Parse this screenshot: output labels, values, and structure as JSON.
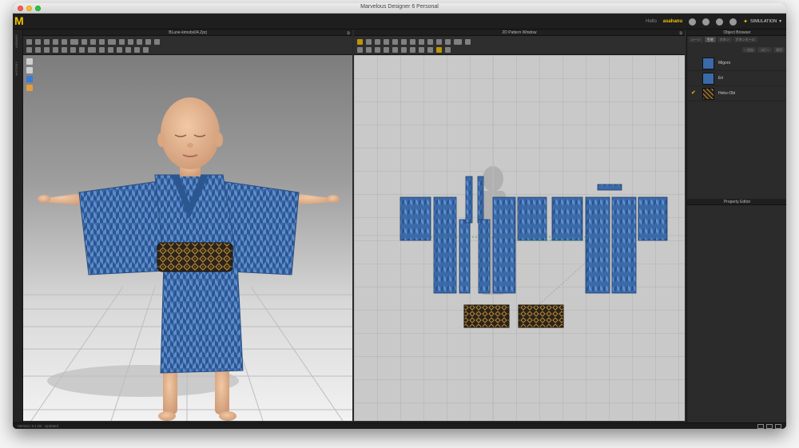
{
  "window": {
    "title": "Marvelous Designer 6 Personal"
  },
  "menu_bar": {
    "logo_letter": "M",
    "user_label": "Hello",
    "user_name": "asahanu",
    "simulation_label": "SIMULATION",
    "icons": [
      "speaker-icon",
      "user-icon",
      "help-icon",
      "cloud-icon",
      "simulation-icon"
    ]
  },
  "left_strip": {
    "labels": [
      "LIBRARY",
      "HISTORY"
    ]
  },
  "panel_3d": {
    "title": "BLune-kimobs04.Zprj"
  },
  "panel_2d": {
    "title": "2D Pattern Window"
  },
  "object_browser": {
    "title": "Object Browser",
    "tabs": [
      "シーン",
      "生地",
      "ボタン",
      "ボタンホール"
    ],
    "actions": [
      "+ 追加",
      "コピー",
      "適用"
    ],
    "items": [
      {
        "name": "Migoro",
        "color": "#3a6aa8",
        "checked": false
      },
      {
        "name": "Eri",
        "color": "#3a6aa8",
        "checked": false
      },
      {
        "name": "Heko-Obi",
        "color": "#2b2418",
        "checked": true
      }
    ]
  },
  "property_editor": {
    "title": "Property Editor"
  },
  "status_bar": {
    "text": "Version: 6.1.00  ·  Updated"
  },
  "colors": {
    "accent": "#f2c200",
    "fabric_blue": "#3a6aa8",
    "fabric_dark": "#2b2418",
    "obi_gold": "#b8893a"
  }
}
